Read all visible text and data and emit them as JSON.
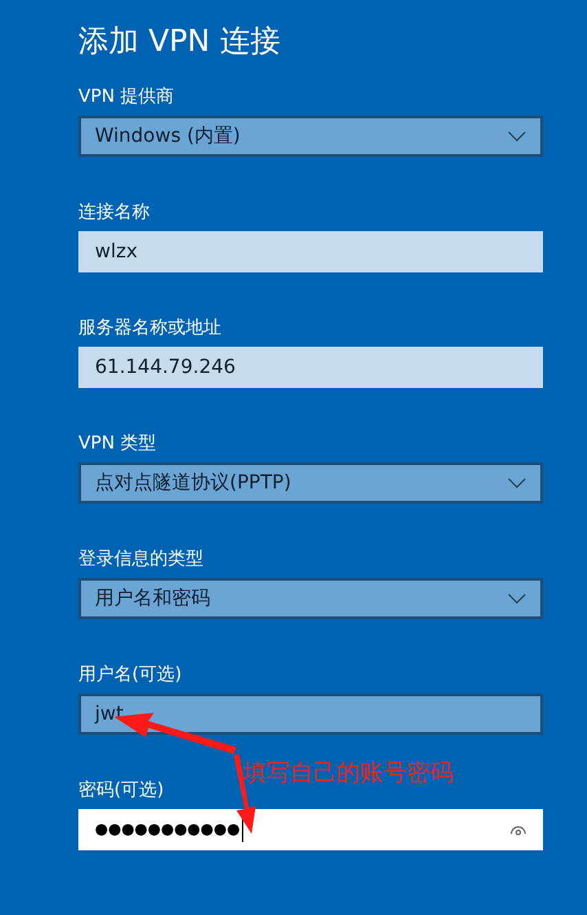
{
  "title": "添加 VPN 连接",
  "fields": [
    {
      "label": "VPN 提供商",
      "kind": "dropdown",
      "value": "Windows (内置)",
      "focused": false
    },
    {
      "label": "连接名称",
      "kind": "text",
      "value": "wlzx",
      "hovered": false,
      "focused": false
    },
    {
      "label": "服务器名称或地址",
      "kind": "text",
      "value": "61.144.79.246",
      "hovered": false,
      "focused": false
    },
    {
      "label": "VPN 类型",
      "kind": "dropdown",
      "value": "点对点隧道协议(PPTP)",
      "focused": false
    },
    {
      "label": "登录信息的类型",
      "kind": "dropdown",
      "value": "用户名和密码",
      "focused": false
    },
    {
      "label": "用户名(可选)",
      "kind": "text",
      "value": "jwt",
      "hovered": true,
      "focused": false
    },
    {
      "label": "密码(可选)",
      "kind": "password",
      "value": "●●●●●●●●●●●",
      "focused": true
    }
  ],
  "annotation": {
    "text": "填写自己的账号密码"
  }
}
